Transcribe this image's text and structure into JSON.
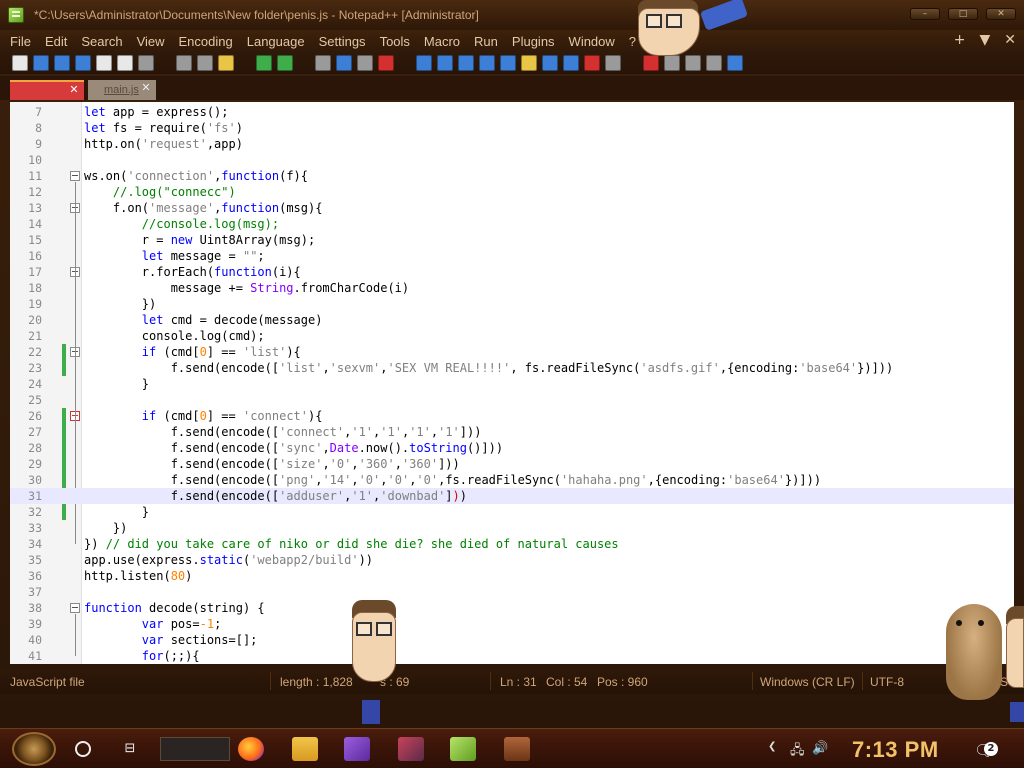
{
  "window": {
    "title": "*C:\\Users\\Administrator\\Documents\\New folder\\penis.js - Notepad++ [Administrator]",
    "controls": [
      "–",
      "□",
      "✕"
    ]
  },
  "menu": {
    "items": [
      "File",
      "Edit",
      "Search",
      "View",
      "Encoding",
      "Language",
      "Settings",
      "Tools",
      "Macro",
      "Run",
      "Plugins",
      "Window",
      "?"
    ],
    "right": [
      "+",
      "▼",
      "✕"
    ]
  },
  "toolbar": {
    "icons": [
      "new-file",
      "open-file",
      "save",
      "save-all",
      "close",
      "close-all",
      "print",
      "cut",
      "copy",
      "paste",
      "undo",
      "redo",
      "find",
      "replace",
      "zoom-in",
      "zoom-out",
      "sync-v",
      "sync-h",
      "word-wrap",
      "all-chars",
      "indent-guide",
      "udl",
      "doc-map",
      "function-list",
      "folder-workspace",
      "monitor",
      "record-macro",
      "stop-macro",
      "play-macro",
      "run-macro-multiple",
      "save-macro"
    ],
    "colors": {
      "blue": "#3d7fd6",
      "green": "#3fae4a",
      "yellow": "#e8c547",
      "red": "#d43030",
      "gray": "#9a9a9a",
      "white": "#e8e8e8"
    }
  },
  "tabs": [
    {
      "label": "",
      "active": true,
      "close": "✕"
    },
    {
      "label": "main.js",
      "active": false,
      "close": "✕"
    }
  ],
  "editor": {
    "current_line": 31,
    "lines": [
      {
        "n": 7,
        "html": "<span class='kw'>let</span> app = express();"
      },
      {
        "n": 8,
        "html": "<span class='kw'>let</span> fs = require(<span class='str'>'fs'</span>)"
      },
      {
        "n": 9,
        "html": "http.on(<span class='str'>'request'</span>,app)"
      },
      {
        "n": 10,
        "html": ""
      },
      {
        "n": 11,
        "html": "ws.on(<span class='str'>'connection'</span>,<span class='kw'>function</span>(f){"
      },
      {
        "n": 12,
        "html": "    <span class='cmt'>//.log(\"connecc\")</span>"
      },
      {
        "n": 13,
        "html": "    f.on(<span class='str'>'message'</span>,<span class='kw'>function</span>(msg){"
      },
      {
        "n": 14,
        "html": "        <span class='cmt'>//console.log(msg);</span>"
      },
      {
        "n": 15,
        "html": "        r = <span class='kw'>new</span> Uint8Array(msg);"
      },
      {
        "n": 16,
        "html": "        <span class='kw'>let</span> message = <span class='str'>\"\"</span>;"
      },
      {
        "n": 17,
        "html": "        r.forEach(<span class='kw'>function</span>(i){"
      },
      {
        "n": 18,
        "html": "            message += <span class='cls'>String</span>.fromCharCode(i)"
      },
      {
        "n": 19,
        "html": "        })"
      },
      {
        "n": 20,
        "html": "        <span class='kw'>let</span> cmd = decode(message)"
      },
      {
        "n": 21,
        "html": "        console.log(cmd);"
      },
      {
        "n": 22,
        "html": "        <span class='kw'>if</span> (cmd[<span class='num'>0</span>] == <span class='str'>'list'</span>){"
      },
      {
        "n": 23,
        "html": "            f.send(encode([<span class='str'>'list'</span>,<span class='str'>'sexvm'</span>,<span class='str'>'SEX VM REAL!!!!'</span>, fs.readFileSync(<span class='str'>'asdfs.gif'</span>,{encoding:<span class='str'>'base64'</span>})]))"
      },
      {
        "n": 24,
        "html": "        }"
      },
      {
        "n": 25,
        "html": ""
      },
      {
        "n": 26,
        "html": "        <span class='kw'>if</span> (cmd[<span class='num'>0</span>] == <span class='str'>'connect'</span>){"
      },
      {
        "n": 27,
        "html": "            f.send(encode([<span class='str'>'connect'</span>,<span class='str'>'1'</span>,<span class='str'>'1'</span>,<span class='str'>'1'</span>,<span class='str'>'1'</span>]))"
      },
      {
        "n": 28,
        "html": "            f.send(encode([<span class='str'>'sync'</span>,<span class='cls'>Date</span>.now().<span class='kw'>toString</span>()]))"
      },
      {
        "n": 29,
        "html": "            f.send(encode([<span class='str'>'size'</span>,<span class='str'>'0'</span>,<span class='str'>'360'</span>,<span class='str'>'360'</span>]))"
      },
      {
        "n": 30,
        "html": "            f.send(encode([<span class='str'>'png'</span>,<span class='str'>'14'</span>,<span class='str'>'0'</span>,<span class='str'>'0'</span>,<span class='str'>'0'</span>,fs.readFileSync(<span class='str'>'hahaha.png'</span>,{encoding:<span class='str'>'base64'</span>})]))"
      },
      {
        "n": 31,
        "html": "            f.send(encode([<span class='str'>'adduser'</span>,<span class='str'>'1'</span>,<span class='str'>'downbad'</span>]<span style='color:#d00'>)</span>)"
      },
      {
        "n": 32,
        "html": "        }"
      },
      {
        "n": 33,
        "html": "    })"
      },
      {
        "n": 34,
        "html": "}) <span class='cmt'>// did you take care of niko or did she die? she died of natural causes</span>"
      },
      {
        "n": 35,
        "html": "app.use(express.<span class='kw'>static</span>(<span class='str'>'webapp2/build'</span>))"
      },
      {
        "n": 36,
        "html": "http.listen(<span class='num'>80</span>)"
      },
      {
        "n": 37,
        "html": ""
      },
      {
        "n": 38,
        "html": "<span class='kw'>function</span> decode(string) {"
      },
      {
        "n": 39,
        "html": "        <span class='kw'>var</span> pos=<span class='num'>-1</span>;"
      },
      {
        "n": 40,
        "html": "        <span class='kw'>var</span> sections=[];"
      },
      {
        "n": 41,
        "html": "        <span class='kw'>for</span>(;;){"
      }
    ]
  },
  "statusbar": {
    "filetype": "JavaScript file",
    "length": "length : 1,828",
    "lines": "s : 69",
    "ln": "Ln : 31",
    "col": "Col : 54",
    "pos": "Pos : 960",
    "eol": "Windows (CR LF)",
    "encoding": "UTF-8",
    "mode": "S"
  },
  "taskbar": {
    "clock": "7:13 PM",
    "notifications": "2",
    "apps": [
      "firefox",
      "file-explorer",
      "visual-studio",
      "app-game",
      "notepad-plus-plus",
      "app-calculator"
    ]
  }
}
